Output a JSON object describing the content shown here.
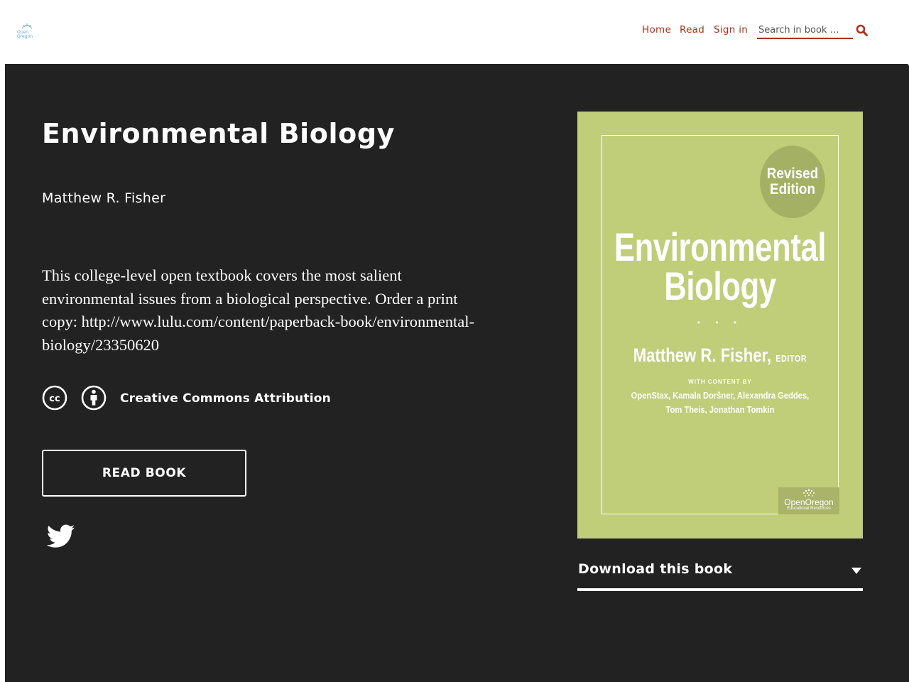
{
  "header": {
    "logo_icon": "open-oregon-logo-icon",
    "nav": [
      {
        "label": "Home"
      },
      {
        "label": "Read"
      },
      {
        "label": "Sign in"
      }
    ],
    "search": {
      "placeholder": "Search in book …",
      "icon": "search-icon"
    },
    "accent_color": "#a8341a"
  },
  "book": {
    "title": "Environmental Biology",
    "author": "Matthew R. Fisher",
    "description": "This college-level open textbook covers the most salient environmental issues from a biological perspective. Order a print copy: http://www.lulu.com/content/paperback-book/environmental-biology/23350620",
    "license": {
      "label": "Creative Commons Attribution",
      "icons": [
        "cc-icon",
        "attribution-icon"
      ]
    },
    "read_button": "READ BOOK",
    "share_icon": "twitter-icon"
  },
  "cover": {
    "badge_line1": "Revised",
    "badge_line2": "Edition",
    "title_line1": "Environmental",
    "title_line2": "Biology",
    "dots": "• • •",
    "editor_name": "Matthew R. Fisher,",
    "editor_role": "EDITOR",
    "with_content": "WITH CONTENT BY",
    "contributors_line1": "OpenStax, Kamala Doršner, Alexandra Geddes,",
    "contributors_line2": "Tom Theis, Jonathan Tomkin",
    "publisher_line1": "OpenOregon",
    "publisher_line2": "Educational Resources",
    "background_color": "#c0cd79"
  },
  "download": {
    "label": "Download this book",
    "icon": "caret-down-icon"
  },
  "theme": {
    "hero_background": "#222222",
    "text_color": "#ffffff"
  }
}
